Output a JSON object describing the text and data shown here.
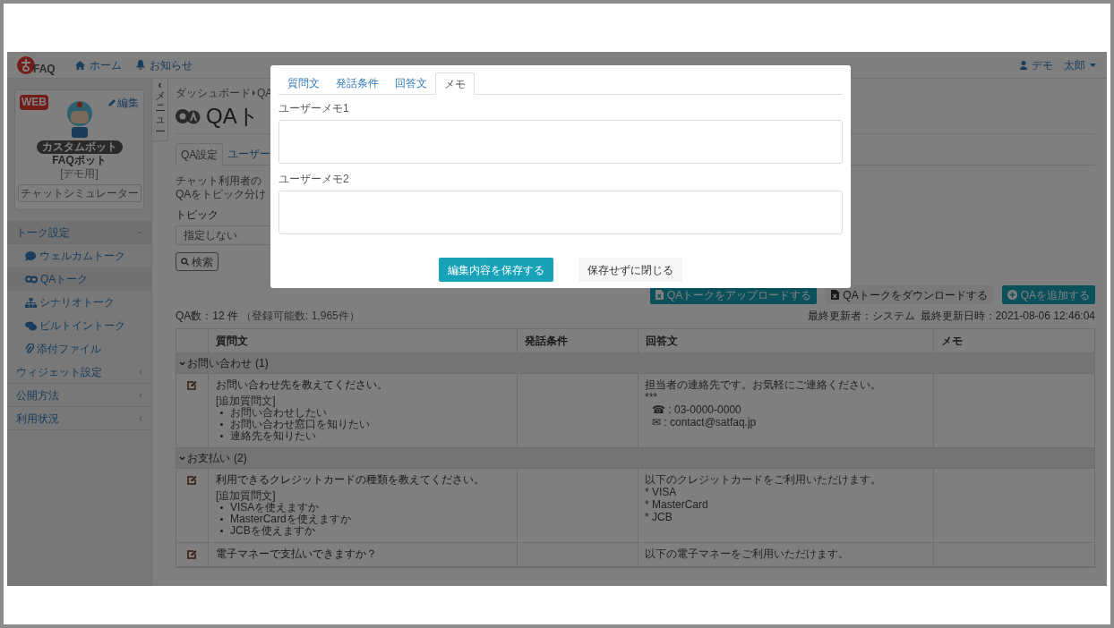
{
  "header": {
    "logo": "FAQ",
    "nav": [
      {
        "label": "ホーム"
      },
      {
        "label": "お知らせ"
      }
    ],
    "user": "デモ　太郎"
  },
  "sidebar": {
    "bot": {
      "badge": "WEB",
      "edit": "編集",
      "tag": "カスタムボット",
      "name": "FAQボット",
      "note": "[デモ用]",
      "simulator": "チャットシミュレーター"
    },
    "items": [
      {
        "label": "トーク設定",
        "expanded": true,
        "children": [
          {
            "label": "ウェルカムトーク",
            "selected": false
          },
          {
            "label": "QAトーク",
            "selected": true
          },
          {
            "label": "シナリオトーク",
            "selected": false
          },
          {
            "label": "ビルトイントーク",
            "selected": false
          },
          {
            "label": "添付ファイル",
            "selected": false
          }
        ]
      },
      {
        "label": "ウィジェット設定",
        "expanded": false
      },
      {
        "label": "公開方法",
        "expanded": false
      },
      {
        "label": "利用状況",
        "expanded": false
      }
    ]
  },
  "menu_toggle": {
    "arrow": "‹",
    "label": "メニュー"
  },
  "breadcrumb": [
    "ダッシュボード",
    "QA"
  ],
  "page_title": "QAト",
  "tabs": [
    {
      "label": "QA設定",
      "selected": true
    },
    {
      "label": "ユーザー",
      "selected": false
    }
  ],
  "description": [
    "チャット利用者の",
    "QAをトピック分け"
  ],
  "topic": {
    "label": "トピック",
    "value": "指定しない"
  },
  "search_button": "検索",
  "actions": [
    {
      "kind": "primary",
      "label": "QAトークをアップロードする"
    },
    {
      "kind": "default",
      "label": "QAトークをダウンロードする"
    },
    {
      "kind": "primary",
      "label": "QAを追加する"
    }
  ],
  "count": "QA数：12 件",
  "capacity": "（登録可能数: 1,965件）",
  "updated_by": "最終更新者：システム",
  "updated_at": "最終更新日時：2021-08-06 12:46:04",
  "table": {
    "columns": [
      "質問文",
      "発話条件",
      "回答文",
      "メモ"
    ],
    "groups": [
      {
        "label": "お問い合わせ",
        "count": "(1)",
        "expanded": true,
        "rows": [
          {
            "question": "お問い合わせ先を教えてください。",
            "extra_label": "[追加質問文]",
            "extra": [
              "お問い合わせしたい",
              "お問い合わせ窓口を知りたい",
              "連絡先を知りたい"
            ],
            "answer": [
              "担当者の連絡先です。お気軽にご連絡ください。",
              "***",
              "☎ : 03-0000-0000",
              "✉ : contact@satfaq.jp"
            ]
          }
        ]
      },
      {
        "label": "お支払い",
        "count": "(2)",
        "expanded": true,
        "rows": [
          {
            "question": "利用できるクレジットカードの種類を教えてください。",
            "extra_label": "[追加質問文]",
            "extra": [
              "VISAを使えますか",
              "MasterCardを使えますか",
              "JCBを使えますか"
            ],
            "answer": [
              "以下のクレジットカードをご利用いただけます。",
              "* VISA",
              "* MasterCard",
              "* JCB"
            ]
          },
          {
            "question": "電子マネーで支払いできますか？",
            "answer": [
              "以下の電子マネーをご利用いただけます。"
            ]
          }
        ]
      }
    ]
  },
  "modal": {
    "tabs": [
      {
        "label": "質問文",
        "selected": false
      },
      {
        "label": "発話条件",
        "selected": false
      },
      {
        "label": "回答文",
        "selected": false
      },
      {
        "label": "メモ",
        "selected": true
      }
    ],
    "fields": [
      {
        "label": "ユーザーメモ1"
      },
      {
        "label": "ユーザーメモ2"
      }
    ],
    "save": "編集内容を保存する",
    "close": "保存せずに閉じる"
  }
}
